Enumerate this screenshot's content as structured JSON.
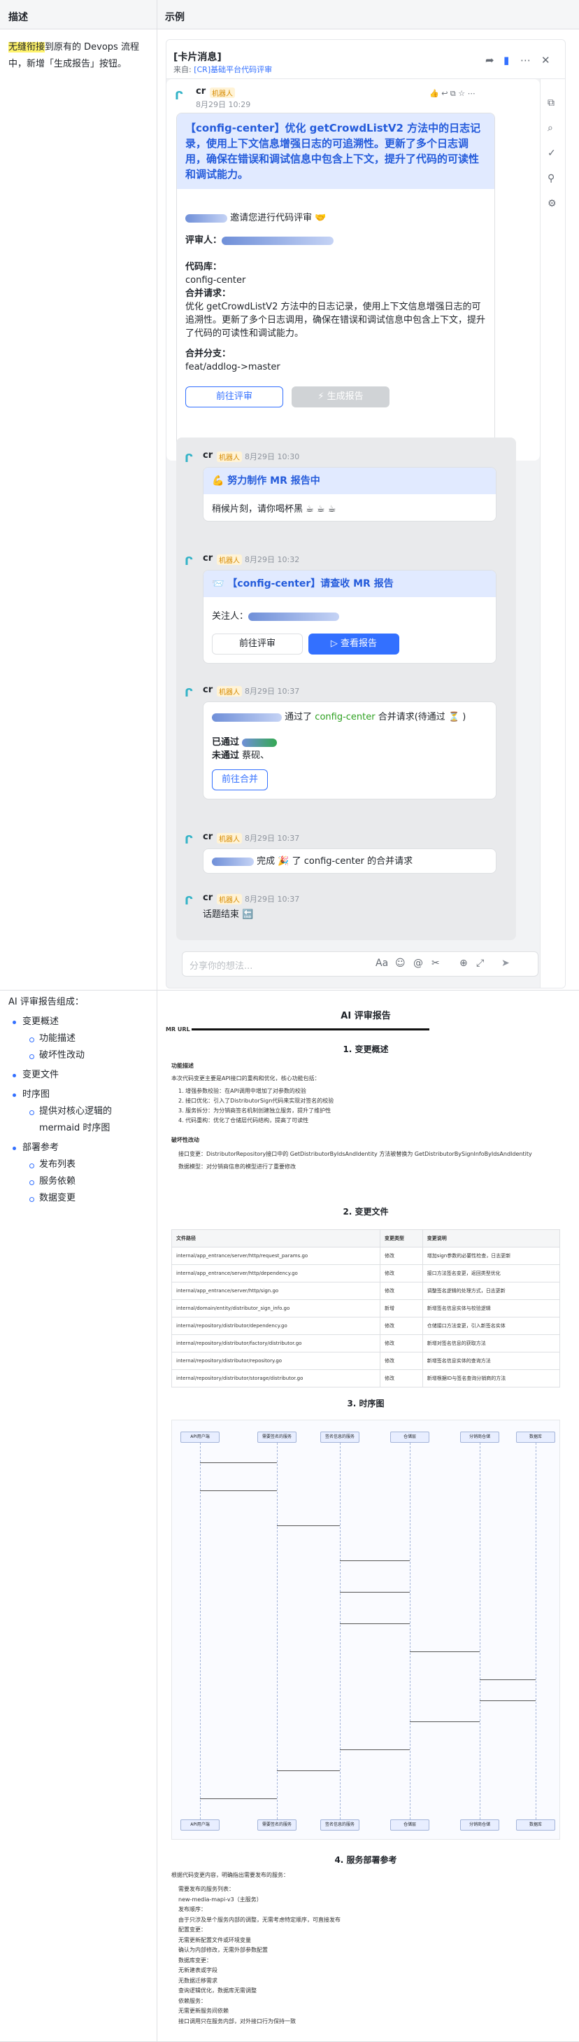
{
  "headers": {
    "desc": "描述",
    "example": "示例"
  },
  "row1": {
    "highlight": "无缝衔接",
    "text": "到原有的 Devops 流程中，新增「生成报告」按钮。"
  },
  "row2": {
    "title": "AI 评审报告组成：",
    "items": [
      {
        "l": 1,
        "t": "变更概述"
      },
      {
        "l": 2,
        "t": "功能描述"
      },
      {
        "l": 2,
        "t": "破坏性改动"
      },
      {
        "l": 1,
        "t": "变更文件"
      },
      {
        "l": 1,
        "t": "时序图"
      },
      {
        "l": 2,
        "t": "提供对核心逻辑的 mermaid 时序图"
      },
      {
        "l": 1,
        "t": "部署参考"
      },
      {
        "l": 2,
        "t": "发布列表"
      },
      {
        "l": 2,
        "t": "服务依赖"
      },
      {
        "l": 2,
        "t": "数据变更"
      }
    ]
  },
  "window": {
    "title": "[卡片消息]",
    "source_prefix": "来自: ",
    "source_link": "[CR]基础平台代码评审",
    "input_placeholder": "分享你的想法..."
  },
  "msg1": {
    "name": "cr",
    "badge": "机器人",
    "time": "8月29日 10:29",
    "header": "【config-center】优化 getCrowdListV2 方法中的日志记录，使用上下文信息增强日志的可追溯性。更新了多个日志调用，确保在错误和调试信息中包含上下文，提升了代码的可读性和调试能力。",
    "invite": "邀请您进行代码评审 🤝",
    "reviewer_label": "评审人：",
    "repo_label": "代码库：",
    "repo": "config-center",
    "merge_label": "合并请求：",
    "merge_text": "优化 getCrowdListV2 方法中的日志记录，使用上下文信息增强日志的可追溯性。更新了多个日志调用，确保在错误和调试信息中包含上下文，提升了代码的可读性和调试能力。",
    "branch_label": "合并分支：",
    "branch": "feat/addlog->master",
    "btn_review": "前往评审",
    "btn_report": "⚡ 生成报告"
  },
  "msg2": {
    "name": "cr",
    "badge": "机器人",
    "time": "8月29日 10:30",
    "header": "💪 努力制作 MR 报告中",
    "text": "稍候片刻，请你喝杯黑 ☕ ☕ ☕"
  },
  "msg3": {
    "name": "cr",
    "badge": "机器人",
    "time": "8月29日 10:32",
    "header": "📨 【config-center】请查收 MR 报告",
    "follow_label": "关注人：",
    "btn_review": "前往评审",
    "btn_view": "▷ 查看报告"
  },
  "msg4": {
    "name": "cr",
    "badge": "机器人",
    "time": "8月29日 10:37",
    "pass_text": "通过了",
    "repo": "config-center",
    "merge_text": "合并请求(待通过 ⏳ )",
    "passed_label": "已通过",
    "rejected_label": "未通过",
    "rejected_val": "蔡砚、",
    "btn_merge": "前往合并"
  },
  "msg5": {
    "name": "cr",
    "badge": "机器人",
    "time": "8月29日 10:37",
    "text": "完成 🎉 了 config-center 的合并请求"
  },
  "msg6": {
    "name": "cr",
    "badge": "机器人",
    "time": "8月29日 10:37",
    "text": "话题结束 🔚"
  },
  "report": {
    "title": "AI 评审报告",
    "mr_url_label": "MR URL",
    "s1": "1. 变更概述",
    "s1a": "功能描述",
    "s1a_text": "本次代码变更主要是API接口的重构和优化，核心功能包括：",
    "s1a_items": [
      "1. 增强参数校验：在API调用中增加了对参数的校验",
      "2. 接口优化：引入了DistributorSign代码来实现对签名的校验",
      "3. 服务拆分：为分销商签名机制创建独立服务，提升了维护性",
      "4. 代码重构：优化了仓储层代码结构，提高了可读性"
    ],
    "s1b": "破坏性改动",
    "s1b_items": [
      "接口变更：DistributorRepository接口中的 GetDistributorByIdsAndIdentity 方法被替换为 GetDistributorBySignInfoByIdsAndIdentity",
      "数据模型：对分销商信息的模型进行了重要修改"
    ],
    "s2": "2. 变更文件",
    "cols": [
      "文件路径",
      "变更类型",
      "变更说明"
    ],
    "rows": [
      [
        "internal/app_entrance/server/http/request_params.go",
        "修改",
        "增加sign参数的必要性检查，日志更新"
      ],
      [
        "internal/app_entrance/server/http/dependency.go",
        "修改",
        "接口方法签名变更，返回类型优化"
      ],
      [
        "internal/app_entrance/server/http/sign.go",
        "修改",
        "调整签名逻辑的处理方式，日志更新"
      ],
      [
        "internal/domain/entity/distributor_sign_info.go",
        "新增",
        "新增签名信息实体与校验逻辑"
      ],
      [
        "internal/repository/distributor/dependency.go",
        "修改",
        "仓储接口方法变更，引入新签名实体"
      ],
      [
        "internal/repository/distributor/factory/distributor.go",
        "修改",
        "新增对签名信息的获取方法"
      ],
      [
        "internal/repository/distributor/repository.go",
        "修改",
        "新增签名信息实体的查询方法"
      ],
      [
        "internal/repository/distributor/storage/distributor.go",
        "修改",
        "新增根据ID与签名查询分销商的方法"
      ]
    ],
    "s3": "3. 时序图",
    "participants": [
      "API用户端",
      "需要签名的服务",
      "签名信息的服务",
      "仓储层",
      "分销商仓储",
      "数据库"
    ],
    "s4": "4. 服务部署参考",
    "s4_text": "根据代码变更内容，明确指出需要发布的服务：",
    "s4_items": [
      "需要发布的服务列表：",
      "new-media-mapi-v3（主服务）",
      "发布顺序：",
      "由于只涉及单个服务内部的调整，无需考虑特定顺序，可直接发布",
      "配置变更：",
      "无需更新配置文件或环境变量",
      "确认为内部修改，无需外部参数配置",
      "数据库变更：",
      "无新建表或字段",
      "无数据迁移需求",
      "查询逻辑优化，数据库无需调整",
      "依赖服务：",
      "无需更新服务间依赖",
      "接口调用只在服务内部，对外接口行为保持一致"
    ]
  }
}
